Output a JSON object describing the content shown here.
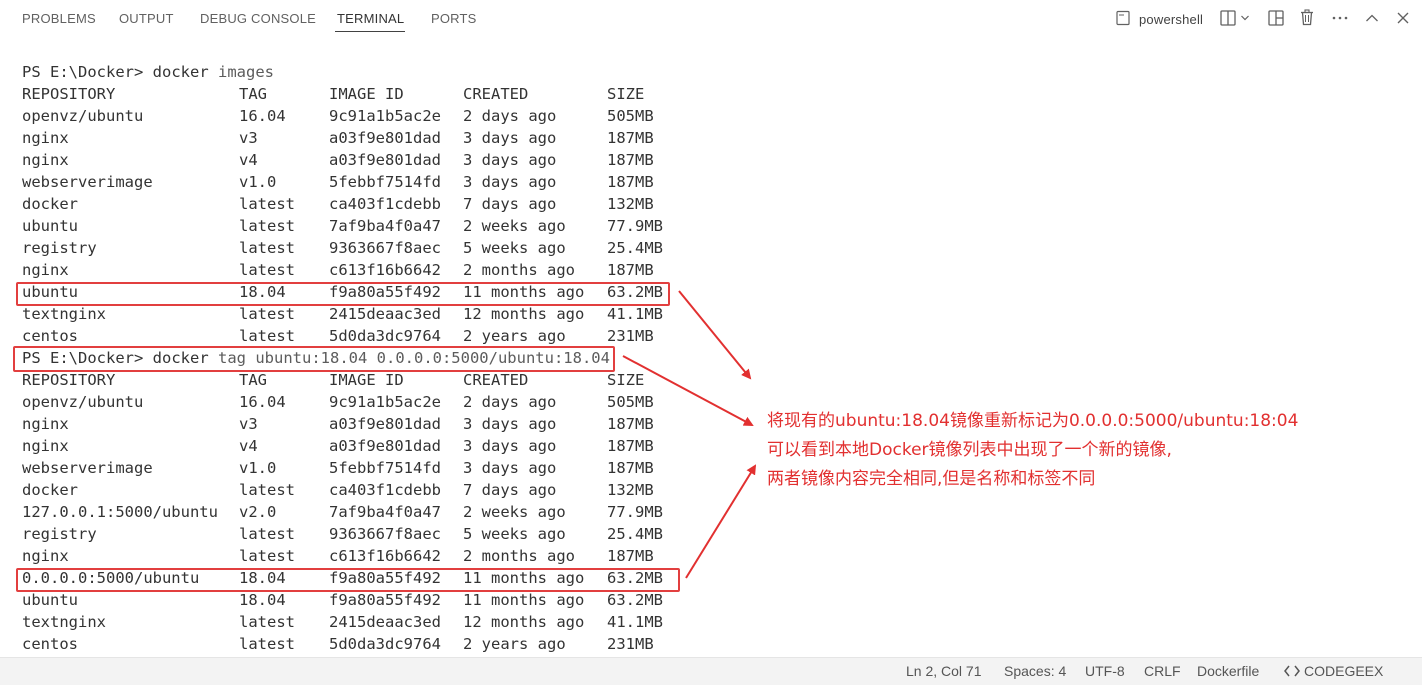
{
  "panel": {
    "tabs": [
      "PROBLEMS",
      "OUTPUT",
      "DEBUG CONSOLE",
      "TERMINAL",
      "PORTS"
    ],
    "active_tab": "TERMINAL",
    "shell_name": "powershell"
  },
  "terminal": {
    "prompt": "PS E:\\Docker>",
    "command1_name": "docker",
    "command1_args": "images",
    "command2_name": "docker",
    "command2_args": "tag ubuntu:18.04 0.0.0.0:5000/ubuntu:18.04",
    "headers": [
      "REPOSITORY",
      "TAG",
      "IMAGE ID",
      "CREATED",
      "SIZE"
    ],
    "table1": [
      [
        "openvz/ubuntu",
        "16.04",
        "9c91a1b5ac2e",
        "2 days ago",
        "505MB"
      ],
      [
        "nginx",
        "v3",
        "a03f9e801dad",
        "3 days ago",
        "187MB"
      ],
      [
        "nginx",
        "v4",
        "a03f9e801dad",
        "3 days ago",
        "187MB"
      ],
      [
        "webserverimage",
        "v1.0",
        "5febbf7514fd",
        "3 days ago",
        "187MB"
      ],
      [
        "docker",
        "latest",
        "ca403f1cdebb",
        "7 days ago",
        "132MB"
      ],
      [
        "ubuntu",
        "latest",
        "7af9ba4f0a47",
        "2 weeks ago",
        "77.9MB"
      ],
      [
        "registry",
        "latest",
        "9363667f8aec",
        "5 weeks ago",
        "25.4MB"
      ],
      [
        "nginx",
        "latest",
        "c613f16b6642",
        "2 months ago",
        "187MB"
      ],
      [
        "ubuntu",
        "18.04",
        "f9a80a55f492",
        "11 months ago",
        "63.2MB"
      ],
      [
        "textnginx",
        "latest",
        "2415deaac3ed",
        "12 months ago",
        "41.1MB"
      ],
      [
        "centos",
        "latest",
        "5d0da3dc9764",
        "2 years ago",
        "231MB"
      ]
    ],
    "table2": [
      [
        "openvz/ubuntu",
        "16.04",
        "9c91a1b5ac2e",
        "2 days ago",
        "505MB"
      ],
      [
        "nginx",
        "v3",
        "a03f9e801dad",
        "3 days ago",
        "187MB"
      ],
      [
        "nginx",
        "v4",
        "a03f9e801dad",
        "3 days ago",
        "187MB"
      ],
      [
        "webserverimage",
        "v1.0",
        "5febbf7514fd",
        "3 days ago",
        "187MB"
      ],
      [
        "docker",
        "latest",
        "ca403f1cdebb",
        "7 days ago",
        "132MB"
      ],
      [
        "127.0.0.1:5000/ubuntu",
        "v2.0",
        "7af9ba4f0a47",
        "2 weeks ago",
        "77.9MB"
      ],
      [
        "registry",
        "latest",
        "9363667f8aec",
        "5 weeks ago",
        "25.4MB"
      ],
      [
        "nginx",
        "latest",
        "c613f16b6642",
        "2 months ago",
        "187MB"
      ],
      [
        "0.0.0.0:5000/ubuntu",
        "18.04",
        "f9a80a55f492",
        "11 months ago",
        "63.2MB"
      ],
      [
        "ubuntu",
        "18.04",
        "f9a80a55f492",
        "11 months ago",
        "63.2MB"
      ],
      [
        "textnginx",
        "latest",
        "2415deaac3ed",
        "12 months ago",
        "41.1MB"
      ],
      [
        "centos",
        "latest",
        "5d0da3dc9764",
        "2 years ago",
        "231MB"
      ]
    ]
  },
  "annotation": {
    "line1": "将现有的ubuntu:18.04镜像重新标记为0.0.0.0:5000/ubuntu:18:04",
    "line2": "可以看到本地Docker镜像列表中出现了一个新的镜像,",
    "line3": "两者镜像内容完全相同,但是名称和标签不同",
    "color": "#e23030"
  },
  "statusbar": {
    "position": "Ln 2, Col 71",
    "spaces": "Spaces: 4",
    "encoding": "UTF-8",
    "eol": "CRLF",
    "language": "Dockerfile",
    "extension": "CODEGEEX"
  },
  "icons": {
    "terminal_icon": "terminal-icon",
    "split": "split-terminal-icon",
    "dropdown": "chevron-down-icon",
    "layout": "panel-layout-icon",
    "trash": "trash-icon",
    "more": "ellipsis-icon",
    "collapse": "chevron-up-icon",
    "close": "close-icon",
    "codegeex": "codegeex-icon"
  }
}
